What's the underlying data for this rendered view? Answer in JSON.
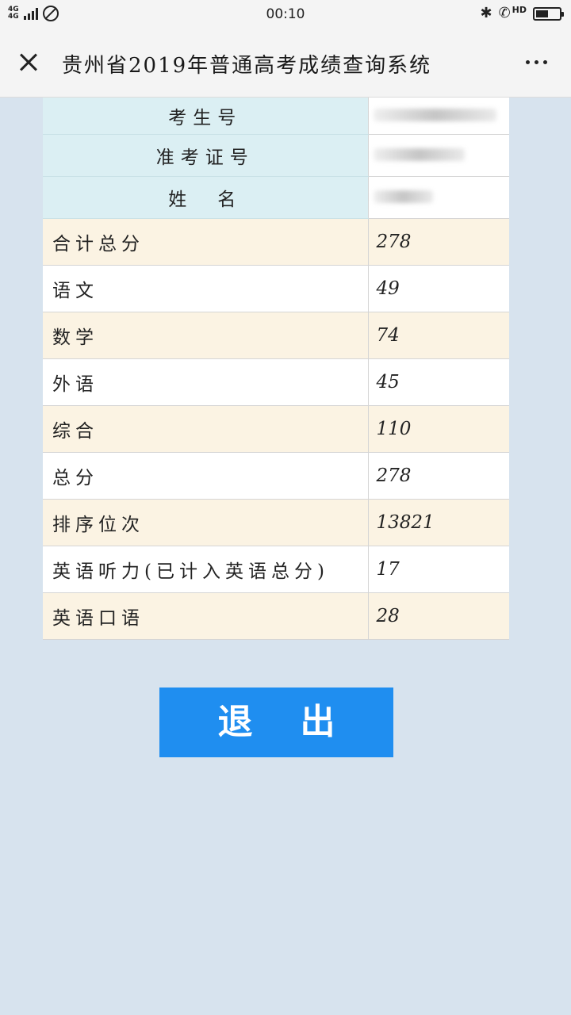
{
  "status_bar": {
    "network_top": "4G",
    "network_bottom": "4G",
    "time": "00:10",
    "hd_label": "HD",
    "battery_level": 0.55
  },
  "header": {
    "title": "贵州省2019年普通高考成绩查询系统"
  },
  "info_rows": [
    {
      "label": "考生号",
      "masked_width": 155
    },
    {
      "label": "准考证号",
      "masked_width": 115
    },
    {
      "label": "姓　名",
      "masked_width": 75
    }
  ],
  "score_rows": [
    {
      "label": "合计总分",
      "value": "278"
    },
    {
      "label": "语文",
      "value": "49"
    },
    {
      "label": "数学",
      "value": "74"
    },
    {
      "label": "外语",
      "value": "45"
    },
    {
      "label": "综合",
      "value": "110"
    },
    {
      "label": "总分",
      "value": "278"
    },
    {
      "label": "排序位次",
      "value": "13821"
    },
    {
      "label": "英语听力(已计入英语总分)",
      "value": "17"
    },
    {
      "label": "英语口语",
      "value": "28"
    }
  ],
  "exit_button": {
    "label": "退出"
  },
  "colors": {
    "button": "#1f8ef0",
    "info_label_bg": "#dbeff3",
    "alt_row_bg": "#fbf3e3",
    "page_bg": "#d7e3ee"
  }
}
